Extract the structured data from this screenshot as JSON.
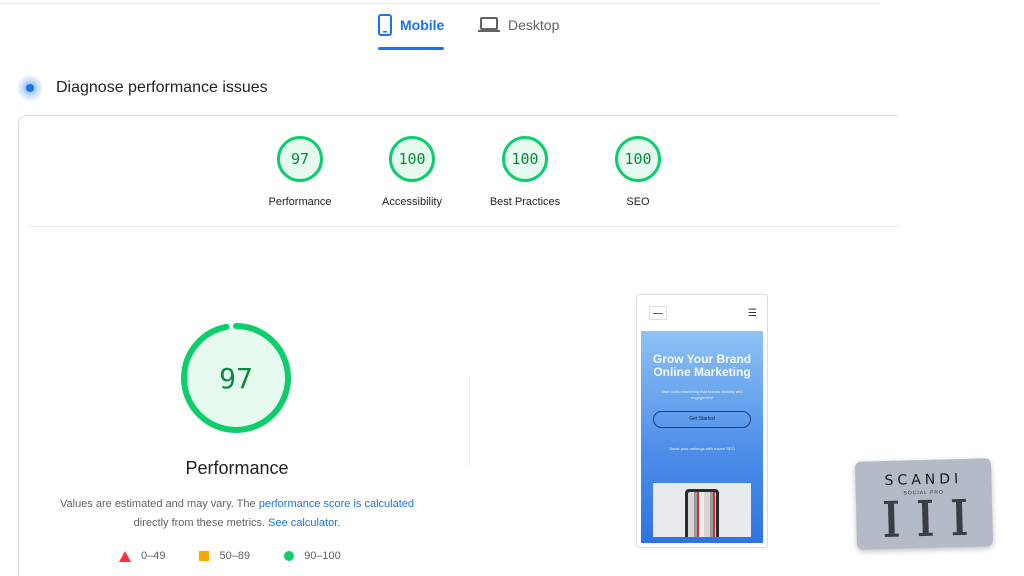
{
  "tabs": {
    "mobile": "Mobile",
    "desktop": "Desktop",
    "active": "Mobile"
  },
  "section": {
    "title": "Diagnose performance issues"
  },
  "categories": [
    {
      "label": "Performance",
      "score": "97"
    },
    {
      "label": "Accessibility",
      "score": "100"
    },
    {
      "label": "Best Practices",
      "score": "100"
    },
    {
      "label": "SEO",
      "score": "100"
    }
  ],
  "main_gauge": {
    "score": "97",
    "score_value": 97,
    "title": "Performance"
  },
  "note": {
    "prefix": "Values are estimated and may vary. The ",
    "link1": "performance score is calculated",
    "middle": " directly from these metrics. ",
    "link2": "See calculator."
  },
  "legend": [
    {
      "shape": "triangle",
      "color": "#ff3333",
      "range": "0–49"
    },
    {
      "shape": "square",
      "color": "#ffa400",
      "range": "50–89"
    },
    {
      "shape": "circle",
      "color": "#0cce6b",
      "range": "90–100"
    }
  ],
  "preview": {
    "headline": "Grow Your Brand Online Marketing",
    "subtext": "Take it into marketing that boosts visibility and engagement",
    "button": "Get Started",
    "small_text": "Boost your rankings with expert SEO"
  },
  "badge": {
    "name": "SCANDI",
    "sub": "SOCIAL PRO"
  },
  "colors": {
    "accent": "#1a73e8",
    "pass": "#0cce6b",
    "pass_text": "#0a8c3c"
  },
  "icons": {
    "mobile": "phone-icon",
    "desktop": "laptop-icon",
    "diagnose": "diagnose-dot-icon",
    "menu": "hamburger-icon"
  }
}
